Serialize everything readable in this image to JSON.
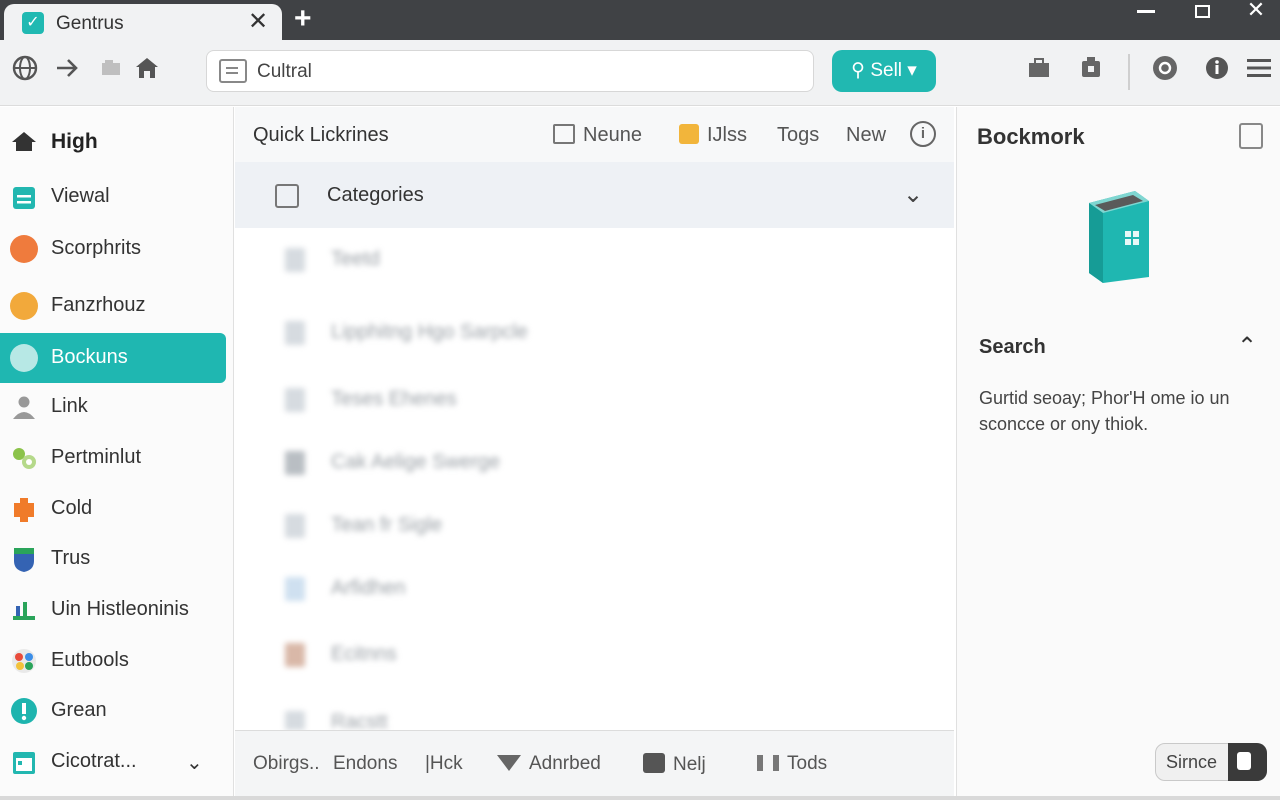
{
  "window": {
    "tab_title": "Gentrus",
    "tab_close": "✕",
    "new_tab": "+",
    "minimize": "",
    "maximize": "",
    "close": "✕"
  },
  "toolbar": {
    "address_value": "Cultral",
    "sell_button": "⚲ Sell ▾"
  },
  "sidebar": {
    "items": [
      {
        "label": "High",
        "icon": "home-icon",
        "color": "#333333"
      },
      {
        "label": "Viewal",
        "icon": "clipboard-icon",
        "color": "#22b7b0"
      },
      {
        "label": "Scorphrits",
        "icon": "orange-circle-icon",
        "color": "#ef7b3d"
      },
      {
        "label": "Fanzrhouz",
        "icon": "yellow-circle-icon",
        "color": "#f2a93b"
      },
      {
        "label": "Bockuns",
        "icon": "lightbulb-icon",
        "color": "#ffffff"
      },
      {
        "label": "Link",
        "icon": "person-icon",
        "color": "#999999"
      },
      {
        "label": "Pertminlut",
        "icon": "molecule-icon",
        "color": "#8bc34a"
      },
      {
        "label": "Cold",
        "icon": "puzzle-icon",
        "color": "#f07b2a"
      },
      {
        "label": "Trus",
        "icon": "shield-icon",
        "color": "#3463b3"
      },
      {
        "label": "Uin Histleoninis",
        "icon": "chart-icon",
        "color": "#2aa45a"
      },
      {
        "label": "Eutbools",
        "icon": "palette-icon",
        "color": "#e84b3b"
      },
      {
        "label": "Grean",
        "icon": "alert-icon",
        "color": "#1eb4ae"
      },
      {
        "label": "Cicotrat...",
        "icon": "calendar-icon",
        "color": "#22b7b0"
      }
    ]
  },
  "main": {
    "title": "Quick Lickrines",
    "actions": [
      "Neune",
      "IJlss",
      "Togs",
      "New"
    ],
    "category_label": "Categories",
    "blurred_rows": [
      "Teetd",
      "Lipphitng Hgo Sarpcle",
      "Teses Ehenes",
      "Cak Aelige Swerge",
      "Tean fr Sigle",
      "Arfidhen",
      "Ecitnns",
      "Racstt"
    ]
  },
  "footer": {
    "items": [
      "Obirgs..",
      "Endons",
      "|Hck",
      "Adnrbed",
      "Nelj",
      "Tods"
    ]
  },
  "right_panel": {
    "title": "Bockmork",
    "section_title": "Search",
    "description": "Gurtid seoay; Phor'H ome io un sconcce or ony thiok.",
    "toggle_label": "Sirnce"
  },
  "colors": {
    "accent": "#1fb7b1",
    "titlebar": "#404245"
  }
}
